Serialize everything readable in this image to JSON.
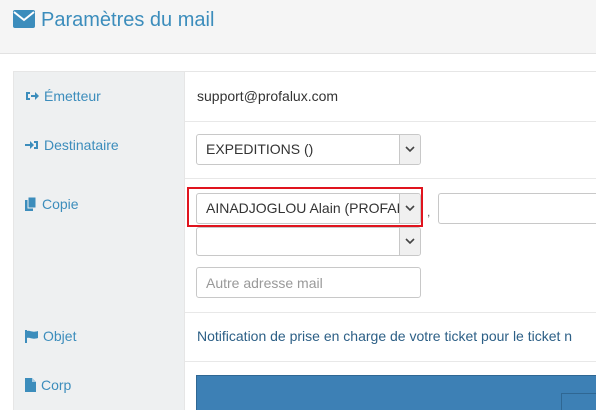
{
  "header": {
    "title": "Paramètres du mail",
    "icon": "envelope-icon"
  },
  "colors": {
    "accent": "#3c8dbc",
    "highlight": "#e0141e",
    "editor": "#3d80b5"
  },
  "rows": {
    "emetteur": {
      "label": "Émetteur",
      "icon": "sign-out-icon",
      "value": "support@profalux.com"
    },
    "destinataire": {
      "label": "Destinataire",
      "icon": "sign-in-icon",
      "select_value": "EXPEDITIONS ()"
    },
    "copie": {
      "label": "Copie",
      "icon": "copy-icon",
      "select1_value": "AINADJOGLOU Alain (PROFALUX)",
      "select2_value": "",
      "separator": ",",
      "extra_input_value": "",
      "other_address_placeholder": "Autre adresse mail"
    },
    "objet": {
      "label": "Objet",
      "icon": "flag-icon",
      "value": "Notification de prise en charge de votre ticket pour le ticket n"
    },
    "corp": {
      "label": "Corp",
      "icon": "file-icon"
    }
  }
}
